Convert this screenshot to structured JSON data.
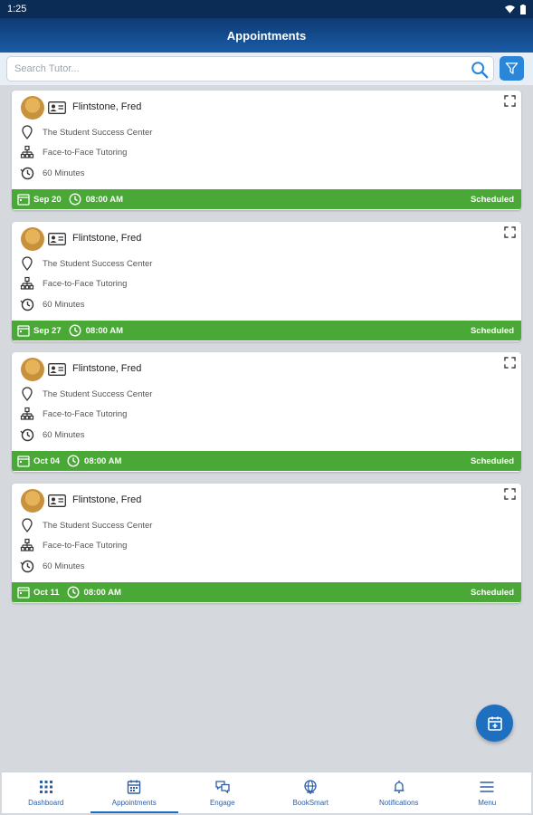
{
  "status_bar": {
    "time": "1:25"
  },
  "app_bar": {
    "title": "Appointments"
  },
  "search": {
    "placeholder": "Search Tutor...",
    "value": ""
  },
  "appointments": [
    {
      "tutor": "Flintstone, Fred",
      "location": "The Student Success Center",
      "type": "Face-to-Face Tutoring",
      "duration": "60 Minutes",
      "date": "Sep 20",
      "time": "08:00 AM",
      "status": "Scheduled"
    },
    {
      "tutor": "Flintstone, Fred",
      "location": "The Student Success Center",
      "type": "Face-to-Face Tutoring",
      "duration": "60 Minutes",
      "date": "Sep 27",
      "time": "08:00 AM",
      "status": "Scheduled"
    },
    {
      "tutor": "Flintstone, Fred",
      "location": "The Student Success Center",
      "type": "Face-to-Face Tutoring",
      "duration": "60 Minutes",
      "date": "Oct 04",
      "time": "08:00 AM",
      "status": "Scheduled"
    },
    {
      "tutor": "Flintstone, Fred",
      "location": "The Student Success Center",
      "type": "Face-to-Face Tutoring",
      "duration": "60 Minutes",
      "date": "Oct 11",
      "time": "08:00 AM",
      "status": "Scheduled"
    }
  ],
  "bottom_nav": [
    {
      "label": "Dashboard",
      "icon": "grid-icon",
      "active": false
    },
    {
      "label": "Appointments",
      "icon": "calendar-icon",
      "active": true
    },
    {
      "label": "Engage",
      "icon": "chat-icon",
      "active": false
    },
    {
      "label": "BookSmart",
      "icon": "globe-icon",
      "active": false
    },
    {
      "label": "Notifications",
      "icon": "bell-icon",
      "active": false
    },
    {
      "label": "Menu",
      "icon": "menu-icon",
      "active": false
    }
  ],
  "colors": {
    "header": "#0e3a73",
    "accent": "#1f6fc1",
    "status_scheduled": "#49a836"
  }
}
